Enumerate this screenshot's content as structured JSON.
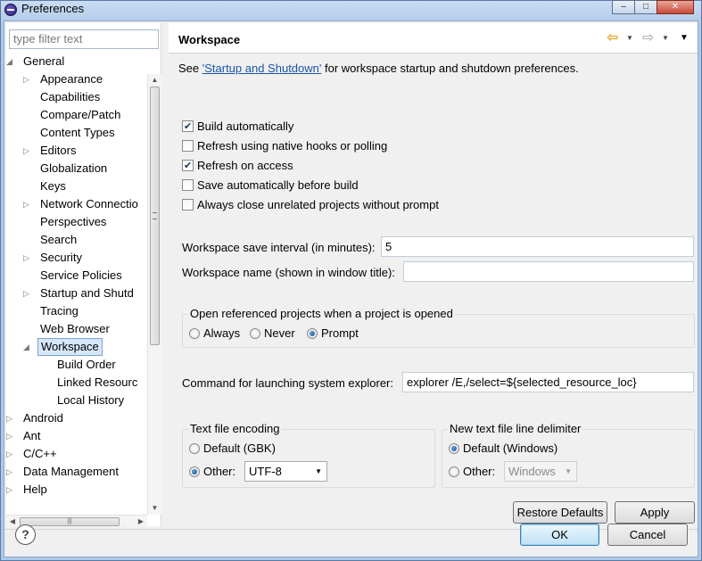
{
  "window": {
    "title": "Preferences"
  },
  "filter": {
    "placeholder": "type filter text"
  },
  "tree": [
    {
      "label": "General",
      "level": 0,
      "twisty": "expanded"
    },
    {
      "label": "Appearance",
      "level": 1,
      "twisty": "collapsed"
    },
    {
      "label": "Capabilities",
      "level": 1,
      "twisty": "none"
    },
    {
      "label": "Compare/Patch",
      "level": 1,
      "twisty": "none"
    },
    {
      "label": "Content Types",
      "level": 1,
      "twisty": "none"
    },
    {
      "label": "Editors",
      "level": 1,
      "twisty": "collapsed"
    },
    {
      "label": "Globalization",
      "level": 1,
      "twisty": "none"
    },
    {
      "label": "Keys",
      "level": 1,
      "twisty": "none"
    },
    {
      "label": "Network Connectio",
      "level": 1,
      "twisty": "collapsed"
    },
    {
      "label": "Perspectives",
      "level": 1,
      "twisty": "none"
    },
    {
      "label": "Search",
      "level": 1,
      "twisty": "none"
    },
    {
      "label": "Security",
      "level": 1,
      "twisty": "collapsed"
    },
    {
      "label": "Service Policies",
      "level": 1,
      "twisty": "none"
    },
    {
      "label": "Startup and Shutd",
      "level": 1,
      "twisty": "collapsed"
    },
    {
      "label": "Tracing",
      "level": 1,
      "twisty": "none"
    },
    {
      "label": "Web Browser",
      "level": 1,
      "twisty": "none"
    },
    {
      "label": "Workspace",
      "level": 1,
      "twisty": "expanded",
      "selected": true
    },
    {
      "label": "Build Order",
      "level": 2,
      "twisty": "none"
    },
    {
      "label": "Linked Resourc",
      "level": 2,
      "twisty": "none"
    },
    {
      "label": "Local History",
      "level": 2,
      "twisty": "none"
    },
    {
      "label": "Android",
      "level": 0,
      "twisty": "collapsed"
    },
    {
      "label": "Ant",
      "level": 0,
      "twisty": "collapsed"
    },
    {
      "label": "C/C++",
      "level": 0,
      "twisty": "collapsed"
    },
    {
      "label": "Data Management",
      "level": 0,
      "twisty": "collapsed"
    },
    {
      "label": "Help",
      "level": 0,
      "twisty": "collapsed"
    }
  ],
  "page": {
    "title": "Workspace",
    "desc_prefix": "See ",
    "desc_link": "'Startup and Shutdown'",
    "desc_suffix": " for workspace startup and shutdown preferences.",
    "checkboxes": [
      {
        "label": "Build automatically",
        "checked": true
      },
      {
        "label": "Refresh using native hooks or polling",
        "checked": false
      },
      {
        "label": "Refresh on access",
        "checked": true
      },
      {
        "label": "Save automatically before build",
        "checked": false
      },
      {
        "label": "Always close unrelated projects without prompt",
        "checked": false
      }
    ],
    "save_interval_label": "Workspace save interval (in minutes):",
    "save_interval_value": "5",
    "workspace_name_label": "Workspace name (shown in window title):",
    "workspace_name_value": "",
    "open_ref": {
      "title": "Open referenced projects when a project is opened",
      "options": [
        "Always",
        "Never",
        "Prompt"
      ],
      "selected": "Prompt"
    },
    "explorer_label": "Command for launching system explorer:",
    "explorer_value": "explorer /E,/select=${selected_resource_loc}",
    "encoding": {
      "title": "Text file encoding",
      "default_label": "Default (GBK)",
      "other_label": "Other:",
      "selected": "other",
      "other_value": "UTF-8"
    },
    "delimiter": {
      "title": "New text file line delimiter",
      "default_label": "Default (Windows)",
      "other_label": "Other:",
      "selected": "default",
      "other_value": "Windows"
    },
    "restore_defaults": "Restore Defaults",
    "apply": "Apply"
  },
  "footer": {
    "help": "?",
    "ok": "OK",
    "cancel": "Cancel"
  },
  "icons": {
    "back": "back-arrow-icon",
    "forward": "forward-arrow-icon",
    "menu": "view-menu-icon",
    "help": "help-icon"
  }
}
